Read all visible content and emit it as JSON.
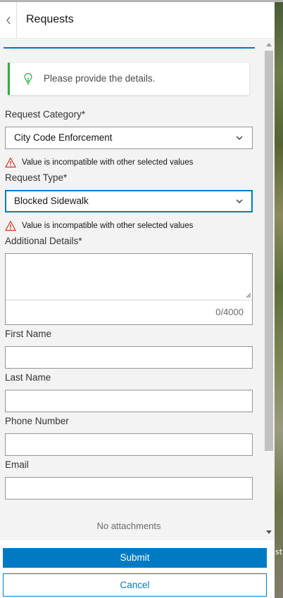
{
  "header": {
    "title": "Requests"
  },
  "notice": {
    "text": "Please provide the details."
  },
  "form": {
    "request_category": {
      "label": "Request Category*",
      "value": "City Code Enforcement",
      "error": "Value is incompatible with other selected values"
    },
    "request_type": {
      "label": "Request Type*",
      "value": "Blocked Sidewalk",
      "error": "Value is incompatible with other selected values"
    },
    "additional_details": {
      "label": "Additional Details*",
      "value": "",
      "counter": "0/4000"
    },
    "first_name": {
      "label": "First Name",
      "value": ""
    },
    "last_name": {
      "label": "Last Name",
      "value": ""
    },
    "phone_number": {
      "label": "Phone Number",
      "value": ""
    },
    "email": {
      "label": "Email",
      "value": ""
    }
  },
  "attachments": {
    "text": "No attachments"
  },
  "footer": {
    "submit_label": "Submit",
    "cancel_label": "Cancel"
  },
  "map": {
    "visible_text": "st"
  },
  "colors": {
    "accent": "#007ac2",
    "success": "#35ac46",
    "error": "#d83020"
  }
}
